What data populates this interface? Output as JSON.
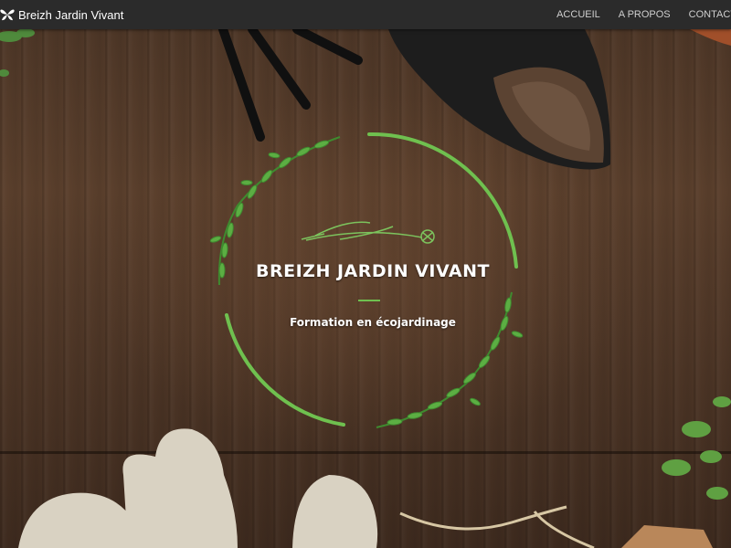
{
  "navbar": {
    "brand_name": "Breizh Jardin Vivant",
    "brand_icon": "butterfly-icon",
    "links": [
      {
        "label": "ACCUEIL"
      },
      {
        "label": "A PROPOS"
      },
      {
        "label": "CONTACT"
      }
    ]
  },
  "hero": {
    "title": "BREIZH JARDIN VIVANT",
    "subtitle": "Formation en écojardinage",
    "accent_color": "#6fc04f"
  }
}
